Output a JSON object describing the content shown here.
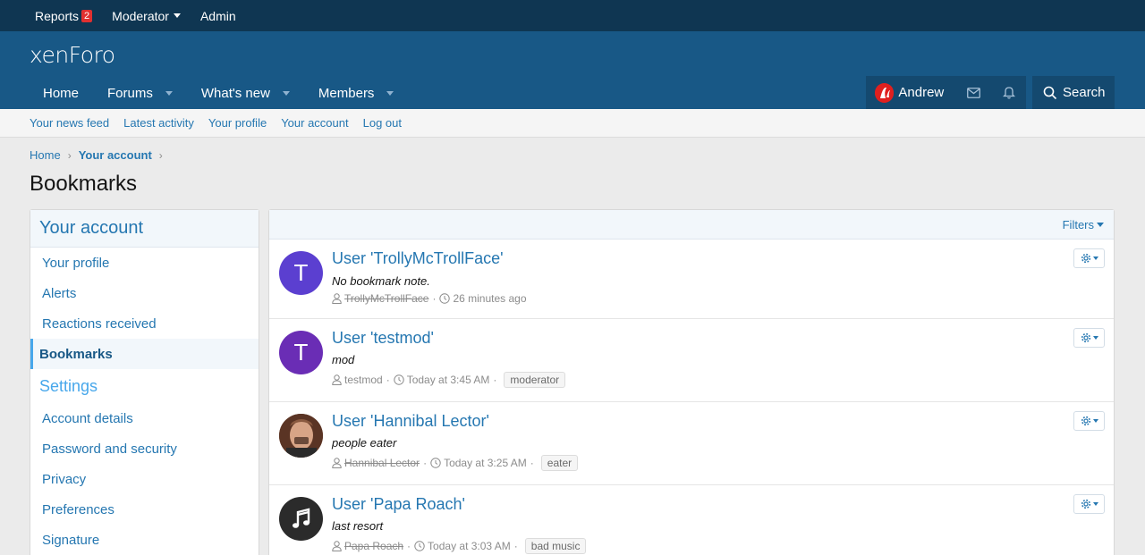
{
  "staff_bar": {
    "reports_label": "Reports",
    "reports_count": "2",
    "moderator_label": "Moderator",
    "admin_label": "Admin"
  },
  "header": {
    "logo_text": "xenForo",
    "nav": [
      {
        "label": "Home"
      },
      {
        "label": "Forums"
      },
      {
        "label": "What's new"
      },
      {
        "label": "Members"
      }
    ],
    "user_name": "Andrew",
    "search_label": "Search"
  },
  "subnav": [
    "Your news feed",
    "Latest activity",
    "Your profile",
    "Your account",
    "Log out"
  ],
  "breadcrumb": [
    "Home",
    "Your account"
  ],
  "page_title": "Bookmarks",
  "sidebar": {
    "heading": "Your account",
    "items": [
      "Your profile",
      "Alerts",
      "Reactions received",
      "Bookmarks"
    ],
    "settings_heading": "Settings",
    "settings_items": [
      "Account details",
      "Password and security",
      "Privacy",
      "Preferences",
      "Signature"
    ]
  },
  "main": {
    "filters_label": "Filters",
    "bookmarks": [
      {
        "title": "User 'TrollyMcTrollFace'",
        "note": "No bookmark note.",
        "user": "TrollyMcTrollFace",
        "time": "26 minutes ago",
        "tag": "",
        "avatar_letter": "T",
        "avatar_color": "#5b3fd0"
      },
      {
        "title": "User 'testmod'",
        "note": "mod",
        "user": "testmod",
        "time": "Today at 3:45 AM",
        "tag": "moderator",
        "avatar_letter": "T",
        "avatar_color": "#6a2db5"
      },
      {
        "title": "User 'Hannibal Lector'",
        "note": "people eater",
        "user": "Hannibal Lector",
        "time": "Today at 3:25 AM",
        "tag": "eater",
        "avatar_letter": "",
        "avatar_color": "#7a4a32"
      },
      {
        "title": "User 'Papa Roach'",
        "note": "last resort",
        "user": "Papa Roach",
        "time": "Today at 3:03 AM",
        "tag": "bad music",
        "avatar_letter": "",
        "avatar_color": "#2b2b2b"
      }
    ]
  },
  "colors": {
    "staff_bar": "#0f3652",
    "header": "#185886",
    "link": "#2577b1"
  }
}
